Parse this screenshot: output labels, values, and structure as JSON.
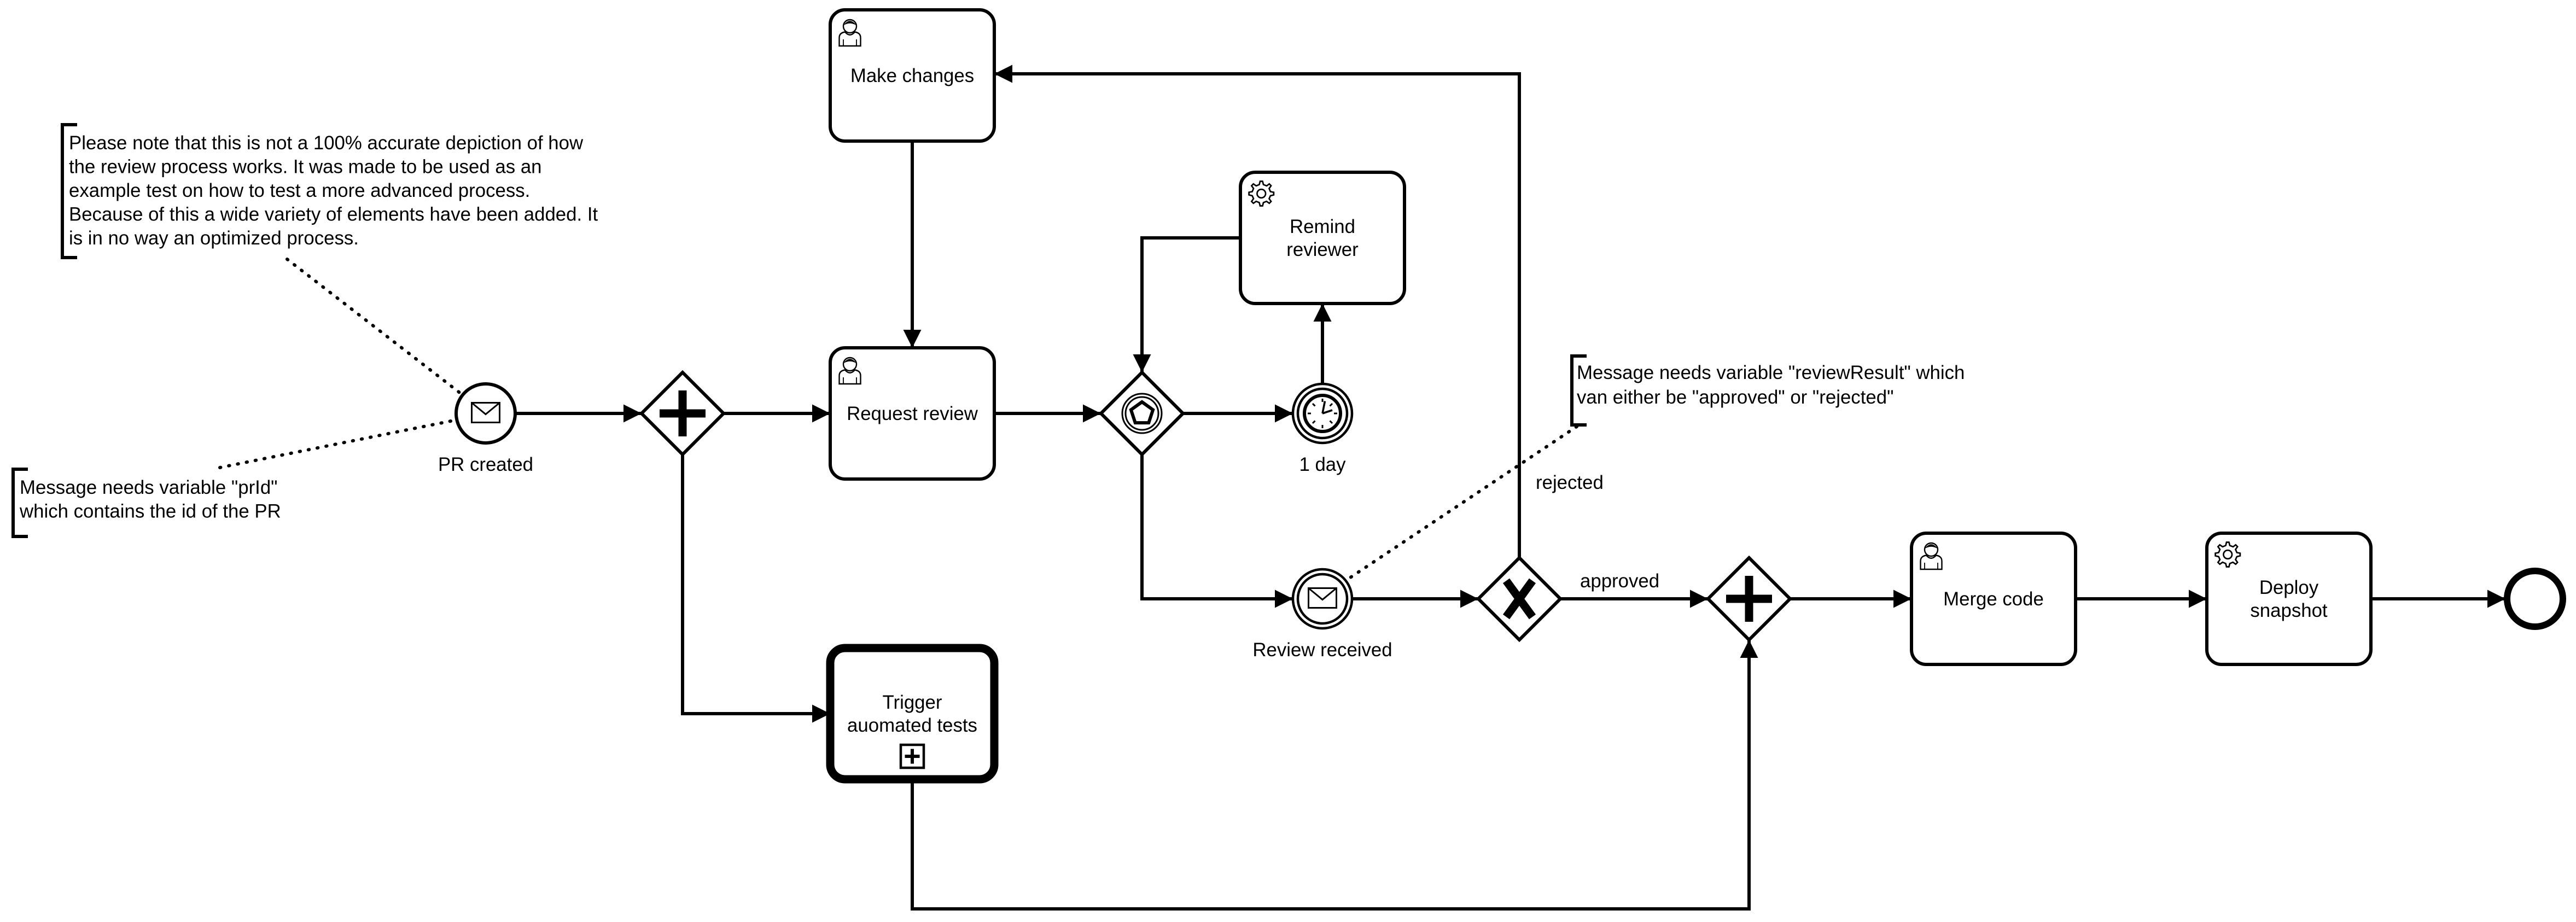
{
  "tasks": {
    "make_changes": {
      "label": [
        "Make changes"
      ],
      "type": "user-task",
      "icon": "user-icon"
    },
    "request_review": {
      "label": [
        "Request review"
      ],
      "type": "user-task",
      "icon": "user-icon"
    },
    "remind_reviewer": {
      "label": [
        "Remind",
        "reviewer"
      ],
      "type": "service-task",
      "icon": "gear-icon"
    },
    "trigger_tests": {
      "label": [
        "Trigger",
        "auomated tests"
      ],
      "type": "call-activity",
      "icon": "subprocess-plus-icon"
    },
    "merge_code": {
      "label": [
        "Merge code"
      ],
      "type": "user-task",
      "icon": "user-icon"
    },
    "deploy_snapshot": {
      "label": [
        "Deploy",
        "snapshot"
      ],
      "type": "service-task",
      "icon": "gear-icon"
    }
  },
  "events": {
    "start": {
      "label": "PR created",
      "type": "message-start-event",
      "icon": "envelope-icon"
    },
    "timer": {
      "label": "1 day",
      "type": "timer-intermediate-event",
      "icon": "clock-icon"
    },
    "review_received": {
      "label": "Review received",
      "type": "message-intermediate-event",
      "icon": "envelope-icon"
    },
    "end": {
      "type": "end-event"
    }
  },
  "gateways": {
    "fork": {
      "type": "parallel",
      "icon": "plus-icon"
    },
    "event_based": {
      "type": "event-based",
      "icon": "pentagon-icon"
    },
    "decision": {
      "type": "exclusive",
      "icon": "x-icon"
    },
    "join": {
      "type": "parallel",
      "icon": "plus-icon"
    }
  },
  "flow_labels": {
    "rejected": "rejected",
    "approved": "approved"
  },
  "annotations": {
    "disclaimer": [
      "Please note that this is not a 100% accurate depiction of how",
      "the review process works. It was made to be used as an",
      "example test on how to test a more advanced process.",
      "Because of this a wide variety of elements have been added. It",
      "is in no way an optimized process."
    ],
    "pr_id": [
      "Message needs variable \"prId\"",
      "which contains the id of the PR"
    ],
    "review_result": [
      "Message needs variable \"reviewResult\" which",
      "van either be \"approved\" or \"rejected\""
    ]
  }
}
